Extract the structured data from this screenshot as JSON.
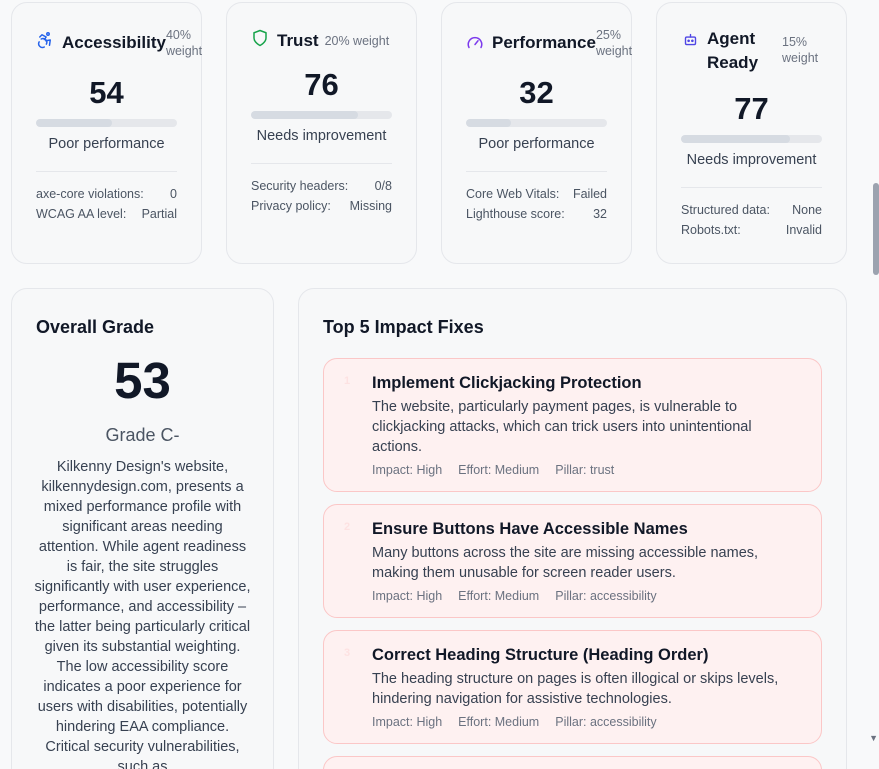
{
  "pillars": [
    {
      "name": "Accessibility",
      "weight": "40% weight",
      "icon": "accessibility-icon",
      "icon_color": "#2563eb",
      "score": "54",
      "score_value": 54,
      "status": "Poor performance",
      "metrics": [
        {
          "label": "axe-core violations:",
          "value": "0"
        },
        {
          "label": "WCAG AA level:",
          "value": "Partial"
        }
      ]
    },
    {
      "name": "Trust",
      "weight": "20% weight",
      "icon": "shield-icon",
      "icon_color": "#16a34a",
      "score": "76",
      "score_value": 76,
      "status": "Needs improvement",
      "metrics": [
        {
          "label": "Security headers:",
          "value": "0/8"
        },
        {
          "label": "Privacy policy:",
          "value": "Missing"
        }
      ]
    },
    {
      "name": "Performance",
      "weight": "25% weight",
      "icon": "gauge-icon",
      "icon_color": "#7c3aed",
      "score": "32",
      "score_value": 32,
      "status": "Poor performance",
      "metrics": [
        {
          "label": "Core Web Vitals:",
          "value": "Failed"
        },
        {
          "label": "Lighthouse score:",
          "value": "32"
        }
      ]
    },
    {
      "name": "Agent Ready",
      "name_line1": "Agent",
      "name_line2": "Ready",
      "weight": "15% weight",
      "weight_line1": "15%",
      "weight_line2": "weight",
      "icon": "robot-icon",
      "icon_color": "#4f46e5",
      "score": "77",
      "score_value": 77,
      "status": "Needs improvement",
      "metrics": [
        {
          "label": "Structured data:",
          "value": "None"
        },
        {
          "label": "Robots.txt:",
          "value": "Invalid"
        }
      ]
    }
  ],
  "overall": {
    "title": "Overall Grade",
    "score": "53",
    "grade": "Grade C-",
    "summary": "Kilkenny Design's website, kilkennydesign.com, presents a mixed performance profile with significant areas needing attention. While agent readiness is fair, the site struggles significantly with user experience, performance, and accessibility – the latter being particularly critical given its substantial weighting. The low accessibility score indicates a poor experience for users with disabilities, potentially hindering EAA compliance. Critical security vulnerabilities, such as"
  },
  "fixes": {
    "title": "Top 5 Impact Fixes",
    "items": [
      {
        "number": "1",
        "title": "Implement Clickjacking Protection",
        "description": "The website, particularly payment pages, is vulnerable to clickjacking attacks, which can trick users into unintentional actions.",
        "impact": "Impact: High",
        "effort": "Effort: Medium",
        "pillar": "Pillar: trust"
      },
      {
        "number": "2",
        "title": "Ensure Buttons Have Accessible Names",
        "description": "Many buttons across the site are missing accessible names, making them unusable for screen reader users.",
        "impact": "Impact: High",
        "effort": "Effort: Medium",
        "pillar": "Pillar: accessibility"
      },
      {
        "number": "3",
        "title": "Correct Heading Structure (Heading Order)",
        "description": "The heading structure on pages is often illogical or skips levels, hindering navigation for assistive technologies.",
        "impact": "Impact: High",
        "effort": "Effort: Medium",
        "pillar": "Pillar: accessibility"
      }
    ]
  }
}
